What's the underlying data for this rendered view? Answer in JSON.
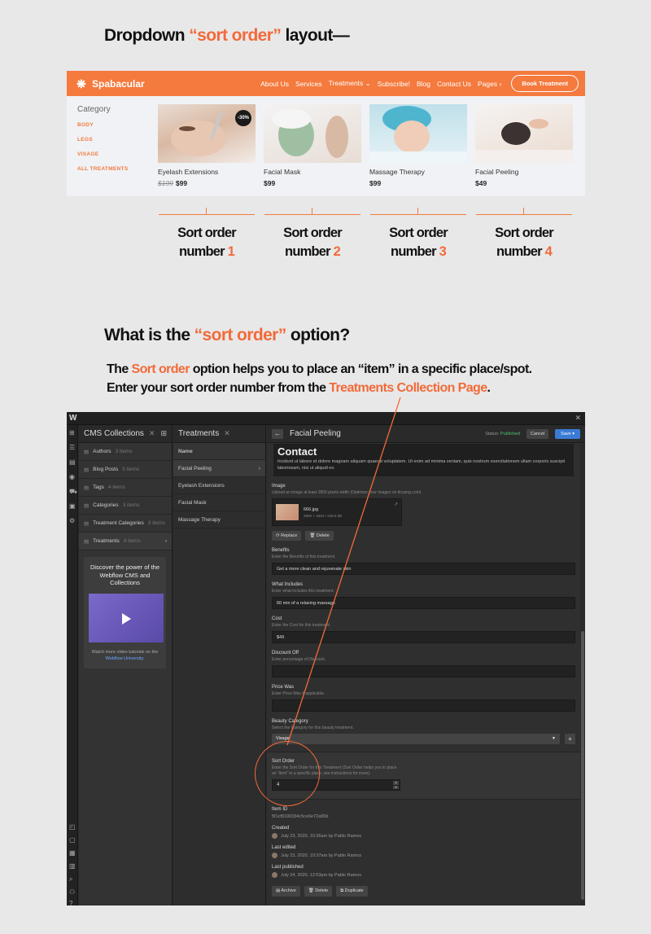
{
  "heading1": {
    "pre": "Dropdown ",
    "accent": "“sort order”",
    "post": " layout—"
  },
  "site": {
    "brand": "Spabacular",
    "nav": [
      "About Us",
      "Services",
      "Treatments ⌄",
      "Subscribe!",
      "Blog",
      "Contact Us",
      "Pages ›"
    ],
    "book_button": "Book Treatment",
    "category_title": "Category",
    "categories": [
      "BODY",
      "LEGS",
      "VISAGE",
      "ALL TREATMENTS"
    ],
    "cards": [
      {
        "name": "Eyelash Extensions",
        "old_price": "$199",
        "price": "$99",
        "badge": "-30%"
      },
      {
        "name": "Facial Mask",
        "old_price": "",
        "price": "$99",
        "badge": ""
      },
      {
        "name": "Massage Therapy",
        "old_price": "",
        "price": "$99",
        "badge": ""
      },
      {
        "name": "Facial Peeling",
        "old_price": "",
        "price": "$49",
        "badge": ""
      }
    ]
  },
  "sort_labels": [
    {
      "line1": "Sort order",
      "word": "number",
      "num": "1"
    },
    {
      "line1": "Sort order",
      "word": "number",
      "num": "2"
    },
    {
      "line1": "Sort order",
      "word": "number",
      "num": "3"
    },
    {
      "line1": "Sort order",
      "word": "number",
      "num": "4"
    }
  ],
  "heading2": {
    "pre": "What is the ",
    "accent": "“sort order”",
    "post": " option?"
  },
  "description": {
    "l1_pre": "The ",
    "l1_accent": "Sort order",
    "l1_post": " option helps you to place an “item” in a specific place/spot.",
    "l2_pre": "Enter your sort order number from the ",
    "l2_accent": "Treatments Collection Page",
    "l2_post": "."
  },
  "webflow": {
    "logo": "W",
    "collections_title": "CMS Collections",
    "collections": [
      {
        "name": "Authors",
        "count": "3 items"
      },
      {
        "name": "Blog Posts",
        "count": "5 items"
      },
      {
        "name": "Tags",
        "count": "4 items"
      },
      {
        "name": "Categories",
        "count": "3 items"
      },
      {
        "name": "Treatment Categories",
        "count": "3 items"
      },
      {
        "name": "Treatments",
        "count": "4 items"
      }
    ],
    "promo_title": "Discover the power of the Webflow CMS and Collections",
    "promo_sub": "Watch more video tutorials on the",
    "promo_link": "Webflow University.",
    "items_title": "Treatments",
    "items_header": "Name",
    "items": [
      "Facial Peeling",
      "Eyelash Extensions",
      "Facial Mask",
      "Massage Therapy"
    ],
    "form": {
      "title": "Facial Peeling",
      "status_label": "Status:",
      "status_value": "Published",
      "cancel": "Cancel",
      "save": "Save",
      "rich_heading": "Contact",
      "rich_text": "Incidunt ut labore et dolore magnam aliquam quaerat voluptatem. Ut enim ad minima veniam, quis nostrum exercitationem ullam corporis suscipit laboriosam, nisi ut aliquid ex.",
      "image_label": "Image",
      "image_hint": "Upload an image at least 2800 pixels width (Optimize your images on tinypng.com).",
      "image_name": "666.jpg",
      "image_meta": "2800 × 1833 • 228.5 kB",
      "replace": "Replace",
      "delete": "Delete",
      "benefits_label": "Benefits",
      "benefits_hint": "Enter the Benefits of this treatment.",
      "benefits_value": "Get a more clean and rejuvenate skin",
      "includes_label": "What Includes",
      "includes_hint": "Enter what includes this treatment.",
      "includes_value": "60 min of a relaxing massage",
      "cost_label": "Cost",
      "cost_hint": "Enter the Cost for this treatment.",
      "cost_value": "$49",
      "discount_label": "Discount Off",
      "discount_hint": "Enter percentage of Discount.",
      "discount_value": "",
      "pricewas_label": "Price Was",
      "pricewas_hint": "Enter Price Was if applicable.",
      "pricewas_value": "",
      "beauty_label": "Beauty Category",
      "beauty_hint": "Select the Category for this beauty treatment.",
      "beauty_value": "Visage",
      "sort_label": "Sort Order",
      "sort_hint": "Enter the Sort Order for this Treatment (Sort Order helps you to place an \"item\" in a specific place, see instructions for more).",
      "sort_value": "4",
      "itemid_label": "Item ID",
      "itemid_value": "5f1cf8190334c5ce6e72a95b",
      "created_label": "Created",
      "created_value": "July 23, 2020, 10:36am by Pablo Ramos",
      "edited_label": "Last edited",
      "edited_value": "July 23, 2020, 10:37am by Pablo Ramos",
      "published_label": "Last published",
      "published_value": "July 24, 2020, 12:53pm by Pablo Ramos",
      "archive": "Archive",
      "delete2": "Delete",
      "duplicate": "Duplicate"
    }
  },
  "colors": {
    "accent": "#f26a3a",
    "nav": "#f47a3e",
    "save": "#3a7bd5",
    "published": "#4ec26f"
  }
}
